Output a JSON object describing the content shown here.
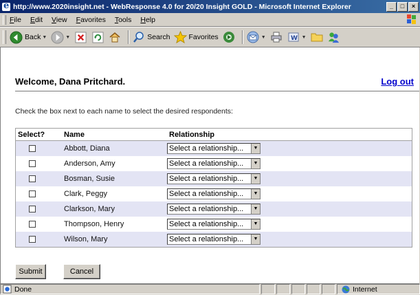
{
  "window": {
    "title": "http://www.2020insight.net - WebResponse 4.0 for 20/20 Insight GOLD - Microsoft Internet Explorer",
    "controls": [
      "minimize-icon",
      "maximize-icon",
      "close-icon"
    ]
  },
  "menu": {
    "items": [
      "File",
      "Edit",
      "View",
      "Favorites",
      "Tools",
      "Help"
    ]
  },
  "toolbar": {
    "back_label": "Back",
    "search_label": "Search",
    "favorites_label": "Favorites",
    "icons": [
      "back-icon",
      "forward-icon",
      "stop-icon",
      "refresh-icon",
      "home-icon",
      "search-icon",
      "favorites-icon",
      "media-icon",
      "mail-icon",
      "print-icon",
      "word-icon",
      "folder-icon",
      "messenger-icon"
    ]
  },
  "page": {
    "welcome": "Welcome, Dana Pritchard.",
    "logout": "Log out",
    "instruction": "Check the box next to each name to select the desired respondents:",
    "headers": {
      "select": "Select?",
      "name": "Name",
      "relationship": "Relationship"
    },
    "rows": [
      {
        "name": "Abbott, Diana",
        "relationship": "Select a relationship...",
        "checked": false
      },
      {
        "name": "Anderson, Amy",
        "relationship": "Select a relationship...",
        "checked": false
      },
      {
        "name": "Bosman, Susie",
        "relationship": "Select a relationship...",
        "checked": false
      },
      {
        "name": "Clark, Peggy",
        "relationship": "Select a relationship...",
        "checked": false
      },
      {
        "name": "Clarkson, Mary",
        "relationship": "Select a relationship...",
        "checked": false
      },
      {
        "name": "Thompson, Henry",
        "relationship": "Select a relationship...",
        "checked": false
      },
      {
        "name": "Wilson, Mary",
        "relationship": "Select a relationship...",
        "checked": false
      }
    ],
    "submit": "Submit",
    "cancel": "Cancel"
  },
  "status": {
    "text": "Done",
    "zone": "Internet"
  },
  "colors": {
    "titlebar": "#0a246a",
    "row_shade": "#e3e4f4",
    "link": "#0000cc"
  }
}
